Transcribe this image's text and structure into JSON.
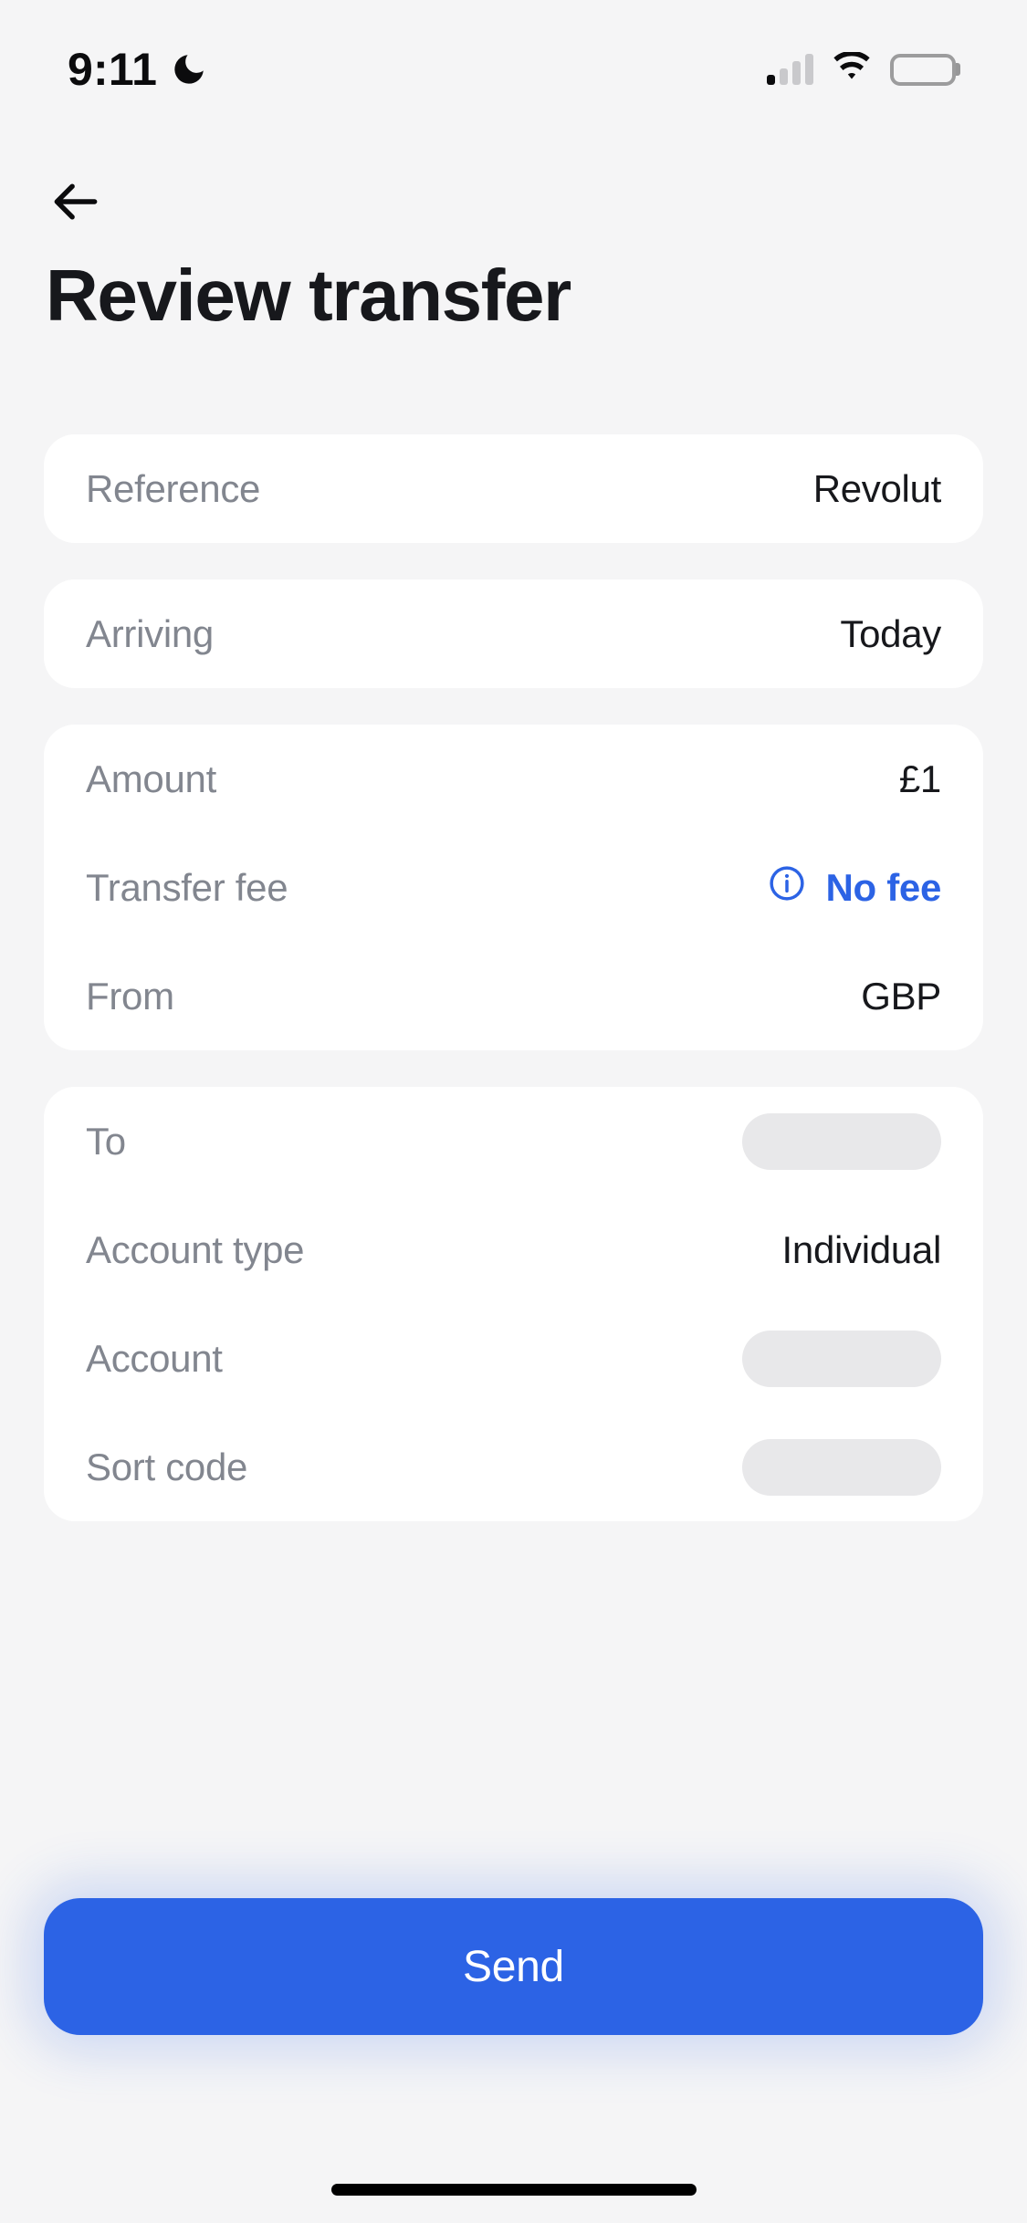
{
  "status_bar": {
    "time": "9:11",
    "dnd_icon": "crescent-moon-icon",
    "signal_icon": "cellular-signal-icon",
    "signal_bars_filled": 1,
    "signal_bars_total": 4,
    "wifi_icon": "wifi-icon",
    "battery_icon": "battery-full-icon"
  },
  "header": {
    "back_icon": "arrow-left-icon",
    "title": "Review transfer"
  },
  "cards": [
    {
      "name": "reference-card",
      "rows": [
        {
          "label": "Reference",
          "value": "Revolut",
          "type": "text"
        }
      ]
    },
    {
      "name": "arriving-card",
      "rows": [
        {
          "label": "Arriving",
          "value": "Today",
          "type": "text"
        }
      ]
    },
    {
      "name": "amount-card",
      "rows": [
        {
          "label": "Amount",
          "value": "£1",
          "type": "text"
        },
        {
          "label": "Transfer fee",
          "value": "No fee",
          "type": "accent",
          "icon": "info-circle-icon"
        },
        {
          "label": "From",
          "value": "GBP",
          "type": "text"
        }
      ]
    },
    {
      "name": "recipient-card",
      "rows": [
        {
          "label": "To",
          "value": "",
          "type": "redacted"
        },
        {
          "label": "Account type",
          "value": "Individual",
          "type": "text"
        },
        {
          "label": "Account",
          "value": "",
          "type": "redacted"
        },
        {
          "label": "Sort code",
          "value": "",
          "type": "redacted"
        }
      ]
    }
  ],
  "footer": {
    "send_label": "Send"
  },
  "colors": {
    "accent": "#2C63E5",
    "page_background": "#F5F5F6",
    "card_background": "#FFFFFF",
    "label_text": "#82868F",
    "value_text": "#17181C",
    "redaction_fill": "#E8E8EA"
  }
}
